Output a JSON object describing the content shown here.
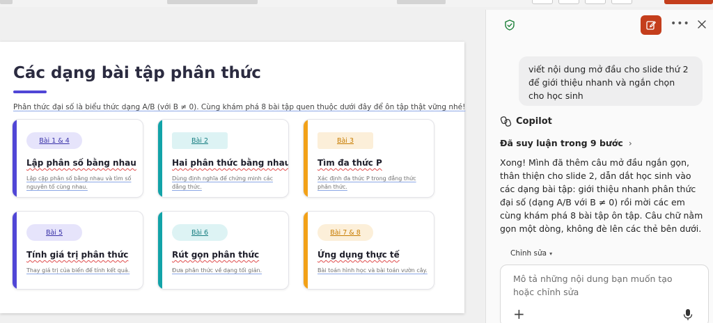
{
  "slide": {
    "title": "Các dạng bài tập phân thức",
    "intro": "Phân thức đại số là biểu thức dạng A/B (với B ≠ 0). Cùng khám phá 8 bài tập quen thuộc dưới đây để ôn tập thật vững nhé!",
    "cards": [
      {
        "badge": "Bài 1 & 4",
        "title": "Lập phân số bằng nhau",
        "desc": "Lập cặp phân số bằng nhau và tìm số nguyên tố cùng nhau.",
        "accent": "#5046d6",
        "badge_bg": "#e6e4fb",
        "badge_fg": "#3a33a8"
      },
      {
        "badge": "Bài 2",
        "title": "Hai phân thức bằng nhau",
        "desc": "Dùng định nghĩa để chứng minh các đẳng thức.",
        "accent": "#12a3a8",
        "badge_bg": "#ddf3f4",
        "badge_fg": "#167d80"
      },
      {
        "badge": "Bài 3",
        "title": "Tìm đa thức P",
        "desc": "Xác định đa thức P trong đẳng thức phân thức.",
        "accent": "#f2a118",
        "badge_bg": "#fcefd9",
        "badge_fg": "#c77c00"
      },
      {
        "badge": "Bài 5",
        "title": "Tính giá trị phân thức",
        "desc": "Thay giá trị của biến để tính kết quả.",
        "accent": "#5046d6",
        "badge_bg": "#e6e4fb",
        "badge_fg": "#3a33a8"
      },
      {
        "badge": "Bài 6",
        "title": "Rút gọn phân thức",
        "desc": "Đưa phân thức về dạng tối giản.",
        "accent": "#12a3a8",
        "badge_bg": "#ddf3f4",
        "badge_fg": "#167d80"
      },
      {
        "badge": "Bài 7 & 8",
        "title": "Ứng dụng thực tế",
        "desc": "Bài toán hình học và bài toán vườn cây.",
        "accent": "#f2a118",
        "badge_bg": "#fcefd9",
        "badge_fg": "#c77c00"
      }
    ]
  },
  "copilot": {
    "user_message": "viết nội dung mở đầu cho slide thứ 2 để giới thiệu nhanh và ngắn chọn cho học sinh",
    "assistant_name": "Copilot",
    "reasoning_label": "Đã suy luận trong 9 bước",
    "answer": "Xong! Mình đã thêm câu mở đầu ngắn gọn, thân thiện cho slide 2, dẫn dắt học sinh vào các dạng bài tập: giới thiệu nhanh phân thức đại số (dạng A/B với B ≠ 0) rồi mời các em cùng khám phá 8 bài tập ôn tập. Câu chữ nằm gọn một dòng, không đè lên các thẻ bên dưới.",
    "mode_label": "Chỉnh sửa",
    "input_placeholder": "Mô tả những nội dung bạn muốn tạo hoặc chỉnh sửa",
    "plus_glyph": "+"
  },
  "colors": {
    "brand": "#c43e1c",
    "shield": "#1a7f37"
  }
}
